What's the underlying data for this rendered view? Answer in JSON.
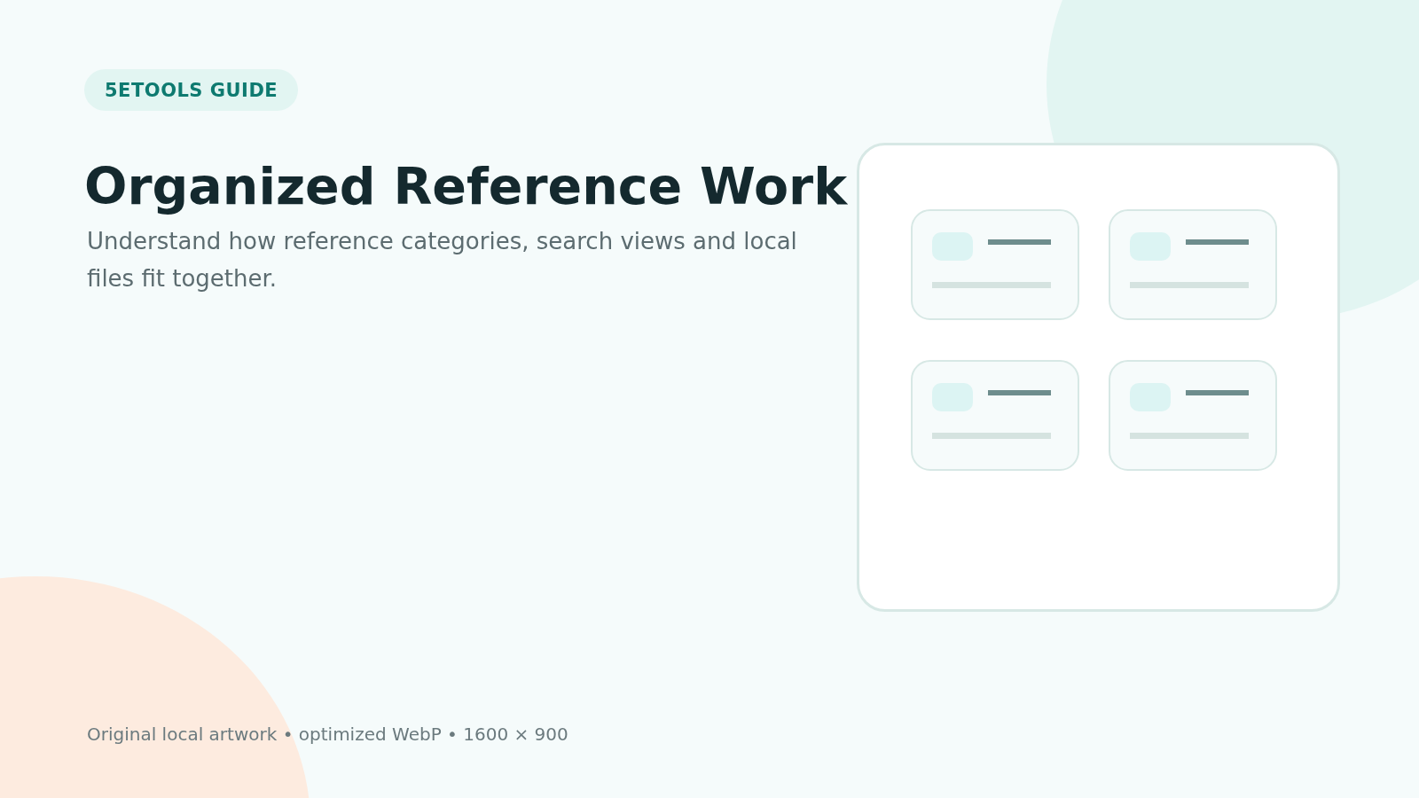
{
  "badge": "5ETOOLS GUIDE",
  "title": "Organized Reference Work",
  "subtitle": "Understand how reference categories, search views and local files fit together.",
  "footer": "Original local artwork • optimized WebP • 1600 × 900"
}
